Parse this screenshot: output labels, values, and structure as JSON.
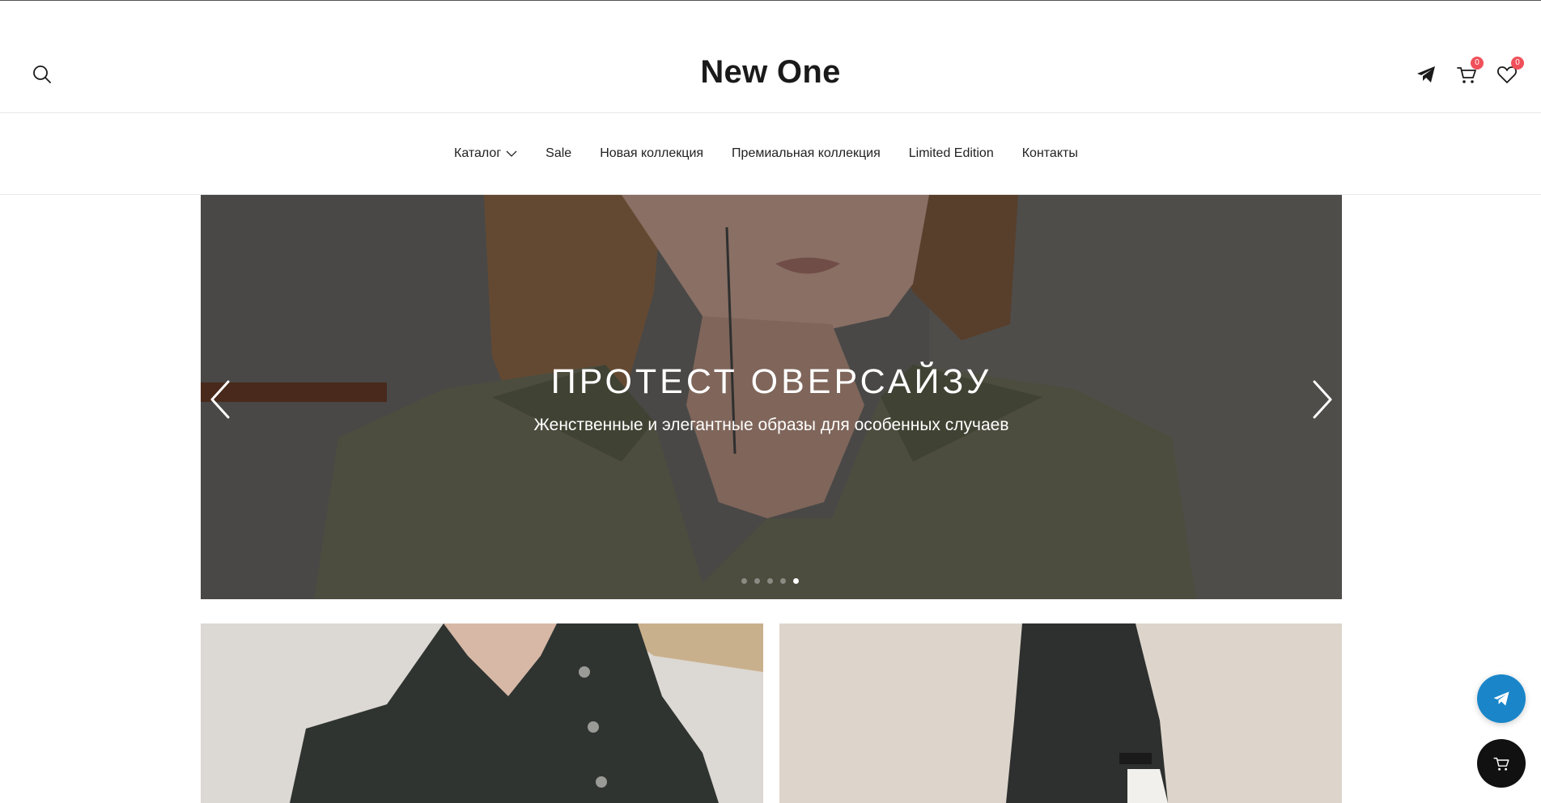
{
  "header": {
    "logo": "New One",
    "cart_count": "0",
    "wishlist_count": "0"
  },
  "nav": {
    "items": [
      {
        "label": "Каталог",
        "has_dropdown": true
      },
      {
        "label": "Sale"
      },
      {
        "label": "Новая коллекция"
      },
      {
        "label": "Премиальная коллекция"
      },
      {
        "label": "Limited Edition"
      },
      {
        "label": "Контакты"
      }
    ]
  },
  "hero": {
    "title": "ПРОТЕСТ ОВЕРСАЙЗУ",
    "subtitle": "Женственные и элегантные образы для особенных случаев",
    "slide_count": 5,
    "active_slide": 5
  },
  "icons": {
    "search": "search-icon",
    "telegram": "telegram-icon",
    "cart": "cart-icon",
    "wishlist": "heart-icon",
    "prev": "chevron-left-icon",
    "next": "chevron-right-icon"
  },
  "colors": {
    "badge": "#f0505a",
    "telegram_fab": "#1a86c9",
    "cart_fab": "#111111"
  }
}
